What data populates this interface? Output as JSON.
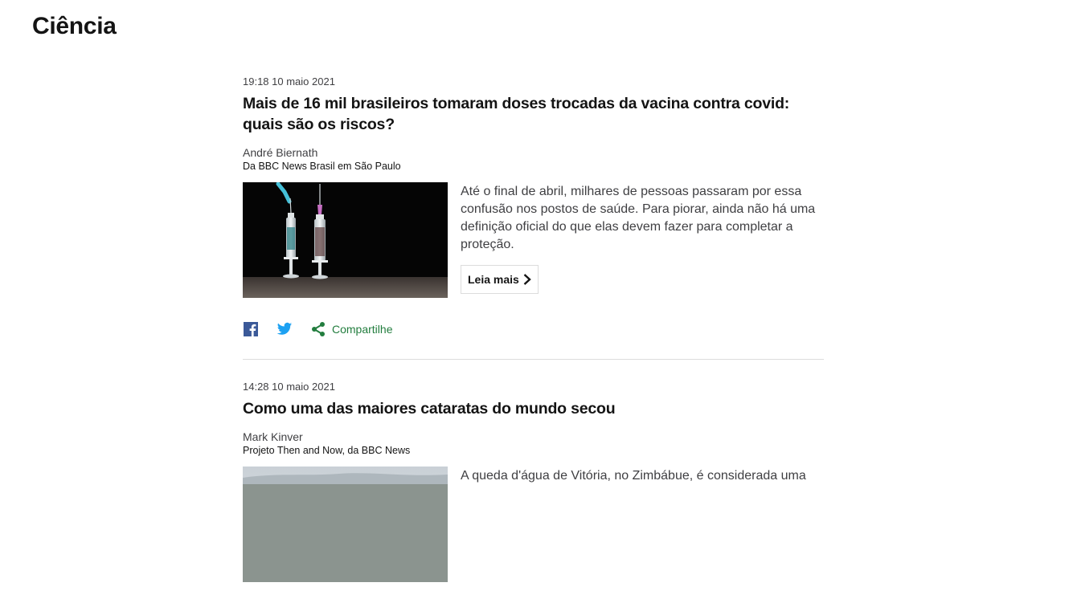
{
  "section": {
    "title": "Ciência"
  },
  "posts": [
    {
      "time": "19:18 10 maio 2021",
      "headline": "Mais de 16 mil brasileiros tomaram doses trocadas da vacina contra covid: quais são os riscos?",
      "author": "André Biernath",
      "author_role": "Da BBC News Brasil em São Paulo",
      "image_icon": "vaccine-syringes-image",
      "summary": "Até o final de abril, milhares de pessoas passaram por essa confusão nos postos de saúde. Para piorar, ainda não há uma definição oficial do que elas devem fazer para completar a proteção.",
      "read_more": "Leia mais",
      "share": {
        "facebook_icon": "facebook-icon",
        "twitter_icon": "twitter-icon",
        "share_icon": "share-icon",
        "share_label": "Compartilhe"
      }
    },
    {
      "time": "14:28 10 maio 2021",
      "headline": "Como uma das maiores cataratas do mundo secou",
      "author": "Mark Kinver",
      "author_role": "Projeto Then and Now, da BBC News",
      "image_icon": "waterfall-image",
      "summary": "A queda d'água de Vitória, no Zimbábue, é considerada uma"
    }
  ],
  "colors": {
    "text": "#141414",
    "muted": "#3f3f42",
    "divider": "#dcdcdc",
    "share_green": "#227d3e",
    "facebook": "#3b5998",
    "twitter": "#1da1f2"
  }
}
